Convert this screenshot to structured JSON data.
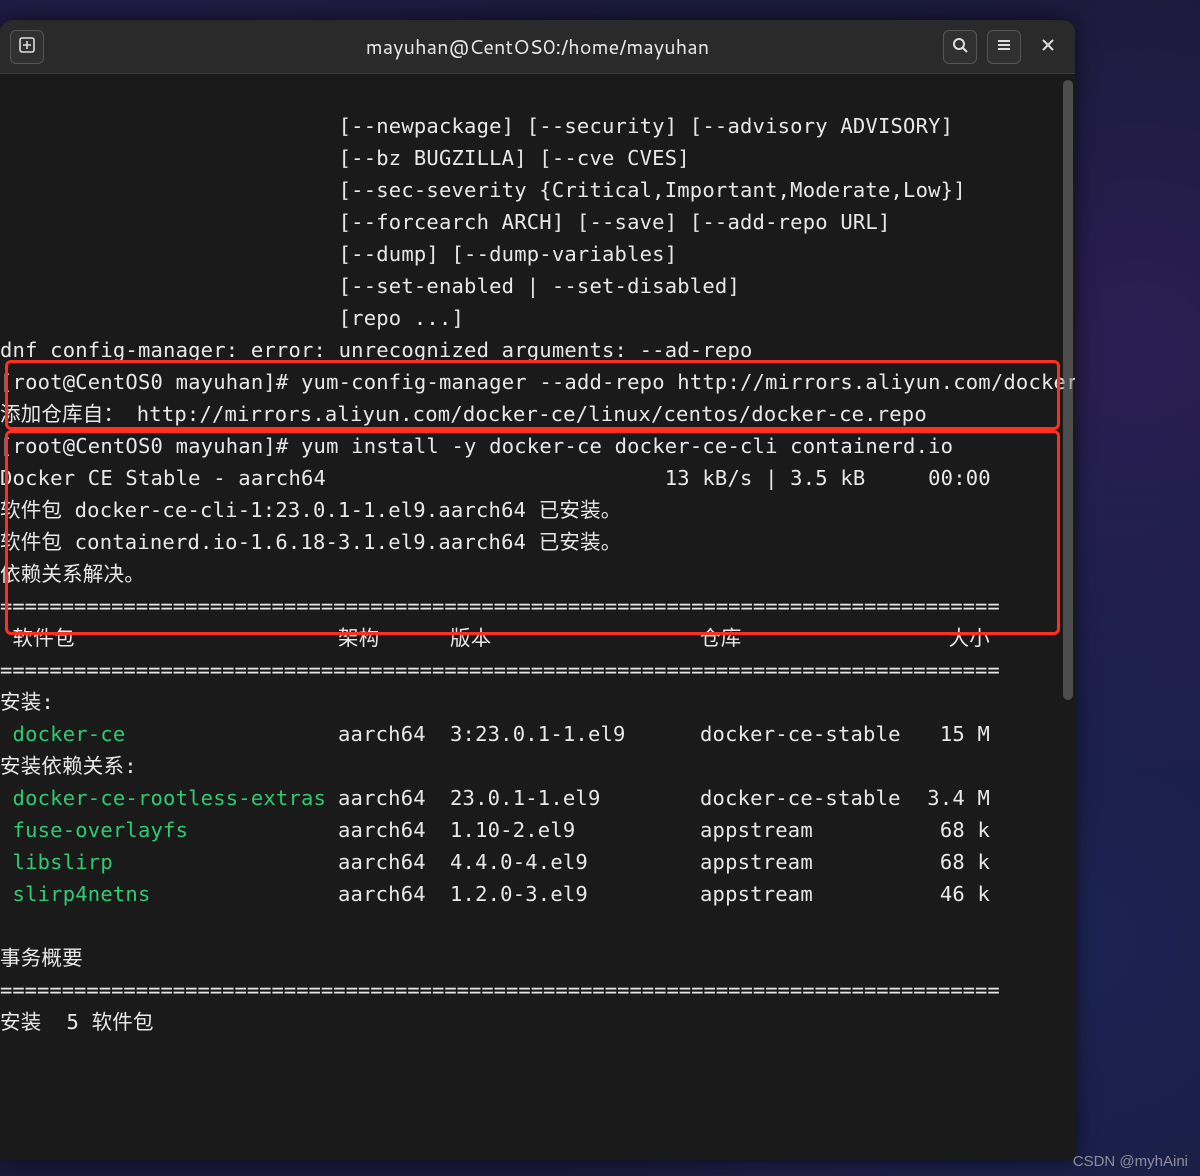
{
  "window": {
    "title": "mayuhan@CentOS0:/home/mayuhan"
  },
  "icons": {
    "newtab_glyph": "⊞",
    "search_glyph": "🔍",
    "menu_glyph": "≡",
    "close_glyph": "✕"
  },
  "help_lines": [
    "                           [--newpackage] [--security] [--advisory ADVISORY]",
    "                           [--bz BUGZILLA] [--cve CVES]",
    "                           [--sec-severity {Critical,Important,Moderate,Low}]",
    "                           [--forcearch ARCH] [--save] [--add-repo URL]",
    "                           [--dump] [--dump-variables]",
    "                           [--set-enabled | --set-disabled]",
    "                           [repo ...]"
  ],
  "error_line": "dnf config-manager: error: unrecognized arguments: --ad-repo",
  "prompt1": "[root@CentOS0 mayuhan]# ",
  "cmd1": "yum-config-manager --add-repo http://mirrors.aliyun.com/docker-ce/linux/centos/docker-ce.repo",
  "add_repo_line": "添加仓库自： http://mirrors.aliyun.com/docker-ce/linux/centos/docker-ce.repo",
  "prompt2": "[root@CentOS0 mayuhan]# ",
  "cmd2": "yum install -y docker-ce docker-ce-cli containerd.io",
  "repo_speed": "Docker CE Stable - aarch64                           13 kB/s | 3.5 kB     00:00",
  "installed1": "软件包 docker-ce-cli-1:23.0.1-1.el9.aarch64 已安装。",
  "installed2": "软件包 containerd.io-1.6.18-3.1.el9.aarch64 已安装。",
  "deps_resolved": "依赖关系解决。",
  "divider_eq": "=================================================================================",
  "divider_dash": "---------------------------------------------------------------------------------",
  "table_header": {
    "pkg": " 软件包",
    "arch": "架构",
    "ver": "版本",
    "repo": "仓库",
    "size": "大小"
  },
  "install_label": "安装:",
  "install_deps_label": "安装依赖关系:",
  "rows_main": [
    {
      "pkg": " docker-ce",
      "arch": "aarch64",
      "ver": "3:23.0.1-1.el9",
      "repo": "docker-ce-stable",
      "size": " 15 M"
    }
  ],
  "rows_deps": [
    {
      "pkg": " docker-ce-rootless-extras",
      "arch": "aarch64",
      "ver": "23.0.1-1.el9",
      "repo": "docker-ce-stable",
      "size": "3.4 M"
    },
    {
      "pkg": " fuse-overlayfs",
      "arch": "aarch64",
      "ver": "1.10-2.el9",
      "repo": "appstream",
      "size": " 68 k"
    },
    {
      "pkg": " libslirp",
      "arch": "aarch64",
      "ver": "4.4.0-4.el9",
      "repo": "appstream",
      "size": " 68 k"
    },
    {
      "pkg": " slirp4netns",
      "arch": "aarch64",
      "ver": "1.2.0-3.el9",
      "repo": "appstream",
      "size": " 46 k"
    }
  ],
  "txn_summary": "事务概要",
  "install_count": "安装  5 软件包",
  "watermark": "CSDN @myhAini"
}
